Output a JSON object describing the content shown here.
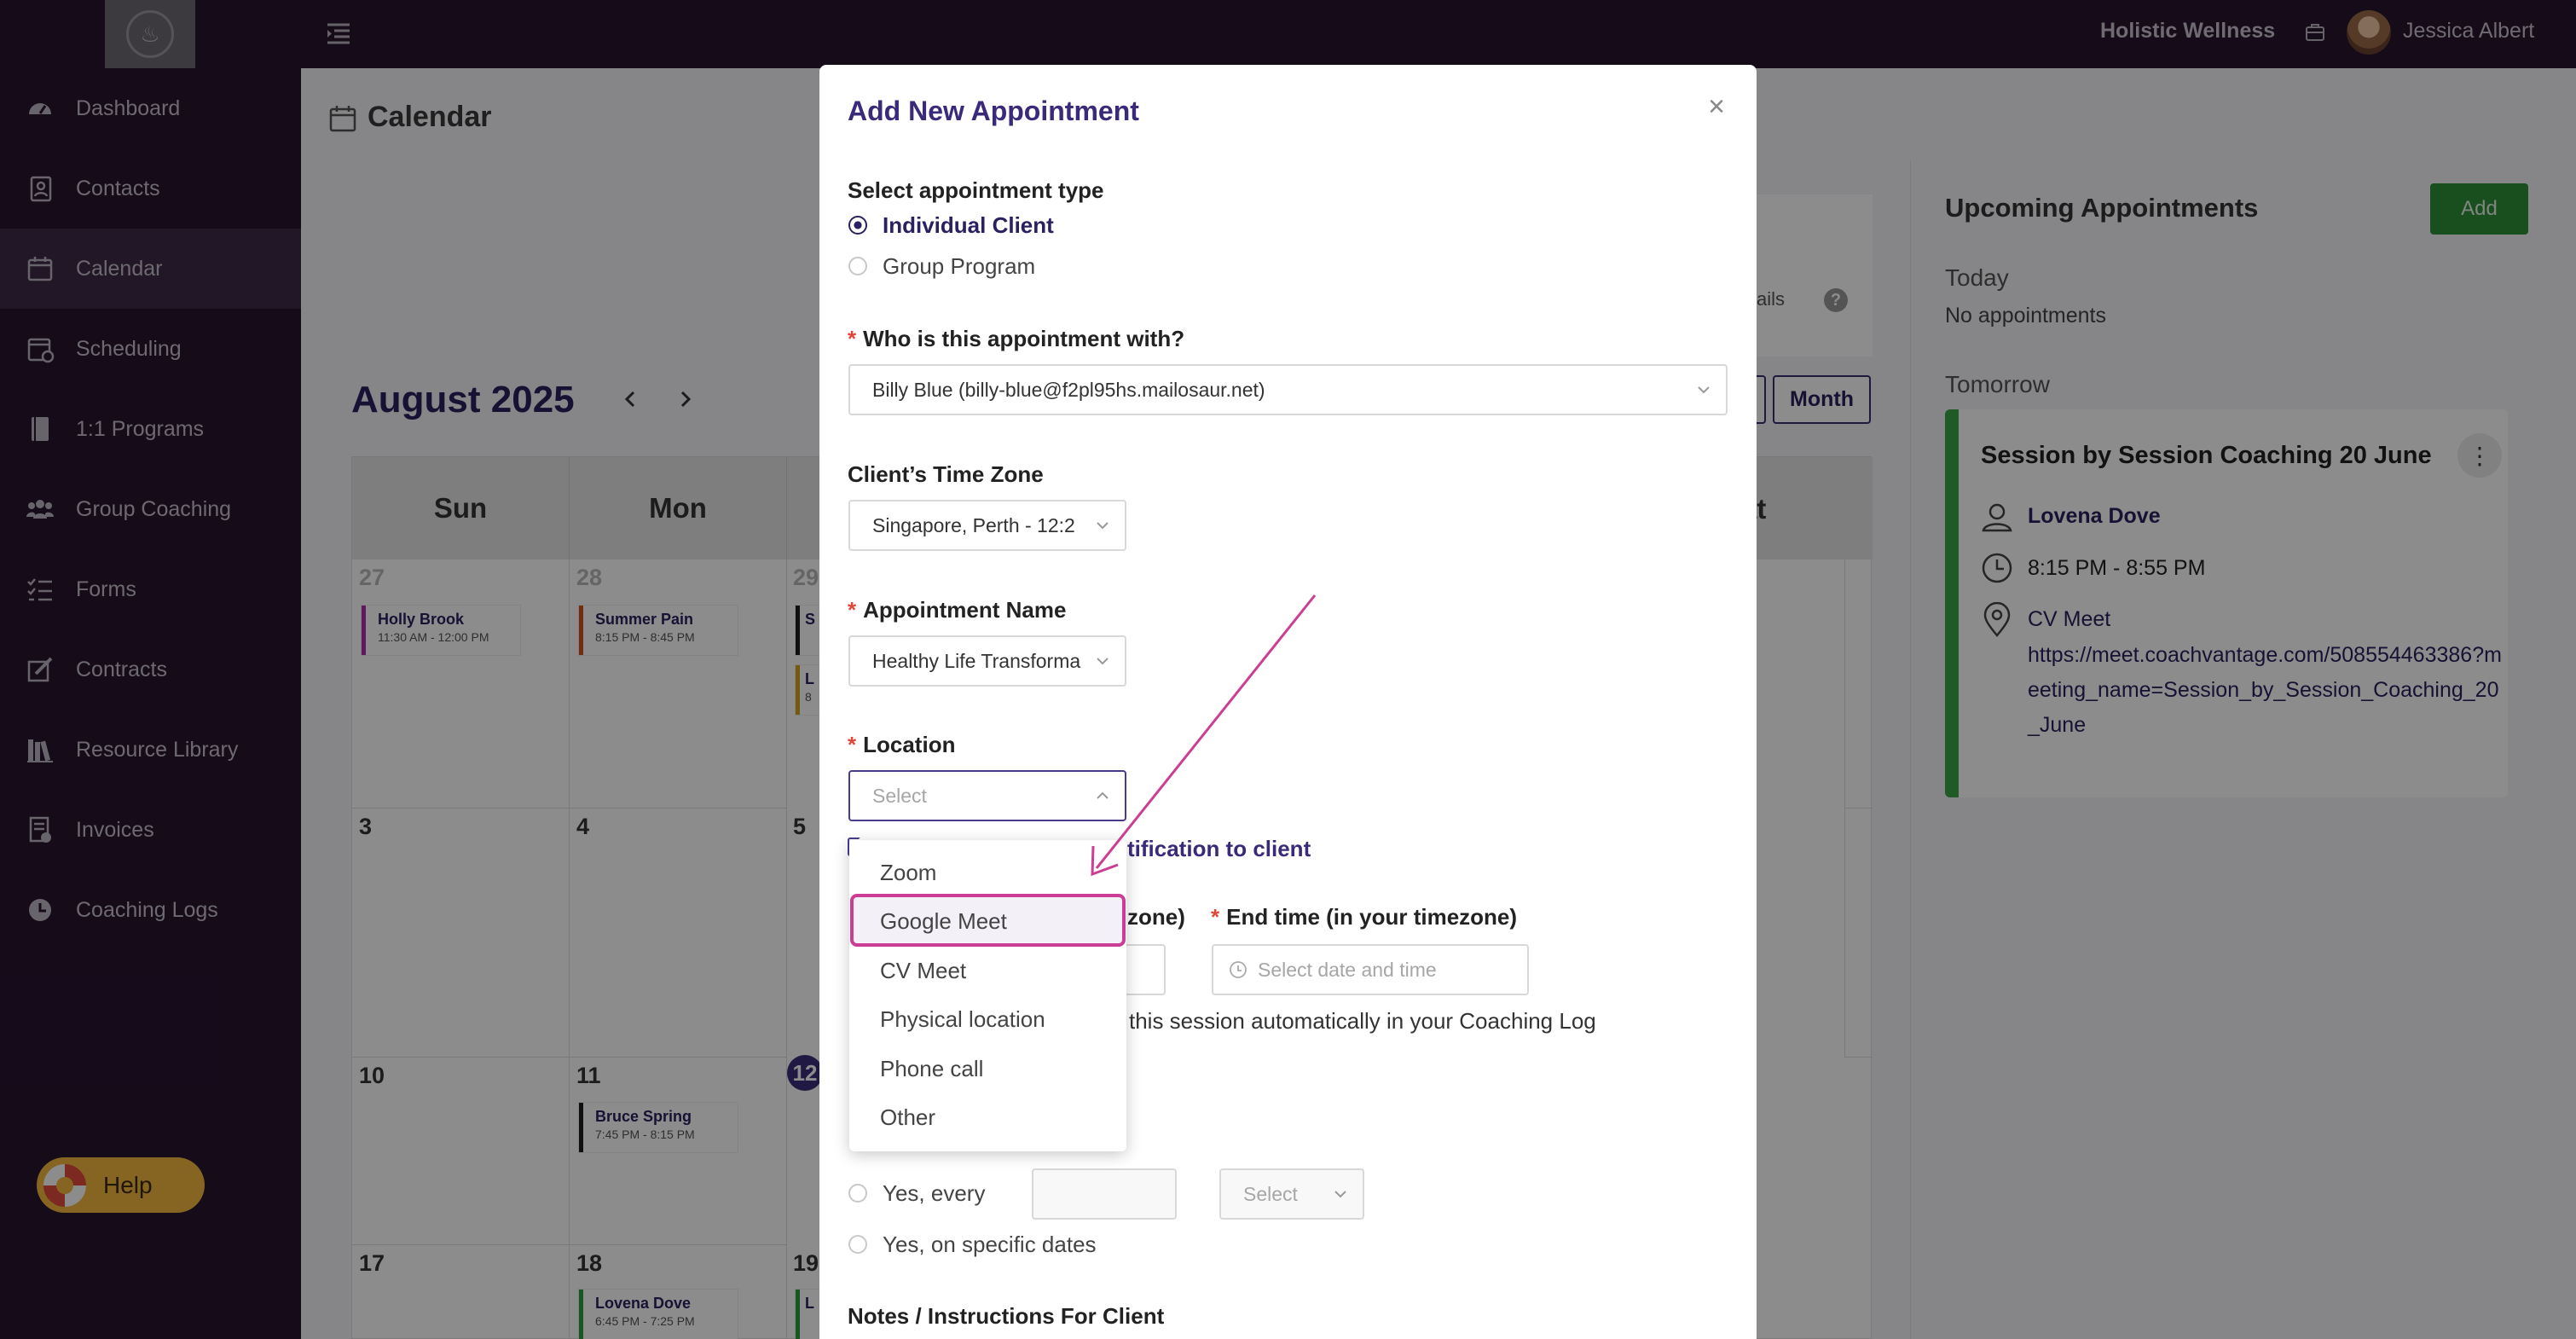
{
  "topbar": {
    "org_name": "Holistic Wellness",
    "user_name": "Jessica Albert"
  },
  "sidebar": {
    "items": [
      {
        "label": "Dashboard",
        "icon": "dashboard-icon"
      },
      {
        "label": "Contacts",
        "icon": "contacts-icon"
      },
      {
        "label": "Calendar",
        "icon": "calendar-icon",
        "active": true
      },
      {
        "label": "Scheduling",
        "icon": "scheduling-icon"
      },
      {
        "label": "1:1 Programs",
        "icon": "book-icon"
      },
      {
        "label": "Group Coaching",
        "icon": "group-icon"
      },
      {
        "label": "Forms",
        "icon": "forms-icon"
      },
      {
        "label": "Contracts",
        "icon": "contract-icon"
      },
      {
        "label": "Resource Library",
        "icon": "library-icon"
      },
      {
        "label": "Invoices",
        "icon": "invoice-icon"
      },
      {
        "label": "Coaching Logs",
        "icon": "clock-icon"
      }
    ],
    "help_label": "Help"
  },
  "calendar": {
    "title": "Calendar",
    "details_label": "ails",
    "month_title": "August 2025",
    "view_button": "Month",
    "days": [
      "Sun",
      "Mon"
    ],
    "sat_label": "at",
    "dates": {
      "r1": [
        "27",
        "28",
        "29"
      ],
      "r2": [
        "3",
        "4",
        "5"
      ],
      "r3": [
        "10",
        "11",
        "12"
      ],
      "r4": [
        "17",
        "18",
        "19"
      ]
    },
    "events": {
      "holly": {
        "name": "Holly Brook",
        "time": "11:30 AM - 12:00 PM"
      },
      "summer": {
        "name": "Summer Pain",
        "time": "8:15 PM - 8:45 PM"
      },
      "bruce": {
        "name": "Bruce Spring",
        "time": "7:45 PM - 8:15 PM"
      },
      "lovena": {
        "name": "Lovena Dove",
        "time": "6:45 PM - 7:25 PM"
      },
      "partial1": {
        "name": "S",
        "time": ""
      },
      "partial2": {
        "name": "L",
        "time": "8"
      },
      "partial3": {
        "name": "L",
        "time": ""
      }
    }
  },
  "upcoming": {
    "title": "Upcoming Appointments",
    "add_label": "Add",
    "today_label": "Today",
    "no_appointments": "No appointments",
    "tomorrow_label": "Tomorrow",
    "appointment": {
      "title": "Session by Session Coaching 20 June",
      "client": "Lovena Dove",
      "time": "8:15 PM - 8:55 PM",
      "location_name": "CV Meet",
      "location_url": "https://meet.coachvantage.com/508554463386?meeting_name=Session_by_Session_Coaching_20_June"
    }
  },
  "modal": {
    "title": "Add New Appointment",
    "type_label": "Select appointment type",
    "type_options": [
      "Individual Client",
      "Group Program"
    ],
    "with_label": "Who is this appointment with?",
    "with_value": "Billy Blue (billy-blue@f2pl95hs.mailosaur.net)",
    "tz_label": "Client’s Time Zone",
    "tz_value": "Singapore, Perth - 12:2",
    "name_label": "Appointment Name",
    "name_value": "Healthy Life Transforma",
    "location_label": "Location",
    "location_placeholder": "Select",
    "location_options": [
      "Zoom",
      "Google Meet",
      "CV Meet",
      "Physical location",
      "Phone call",
      "Other"
    ],
    "notify_text": "tification to client",
    "start_label_tail": "zone)",
    "end_label": "End time (in your timezone)",
    "end_placeholder": "Select date and time",
    "log_text": "this session automatically in your Coaching Log",
    "repeat_options": [
      "Yes, every",
      "Yes, on specific dates"
    ],
    "repeat_unit_placeholder": "Select",
    "notes_label": "Notes / Instructions For Client"
  },
  "colors": {
    "sidebar_bg": "#28142f",
    "brand_purple": "#2b2160",
    "highlight_pink": "#cc3d95",
    "add_green": "#2f8f3a",
    "help_yellow": "#f5b941"
  }
}
